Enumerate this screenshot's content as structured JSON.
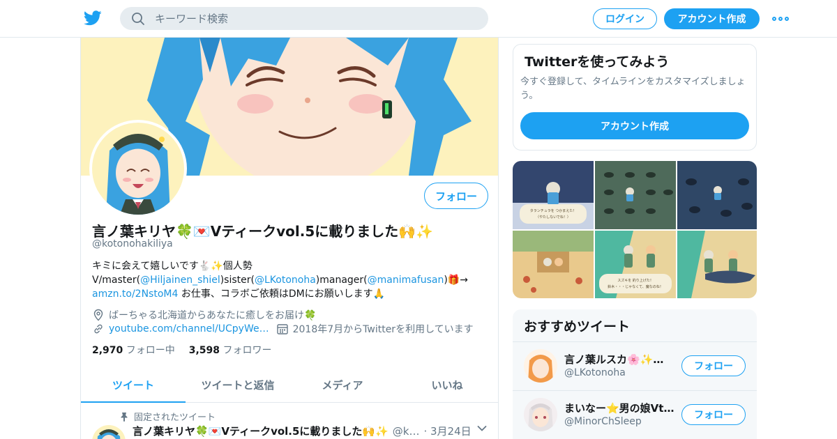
{
  "colors": {
    "brand": "#1da1f2",
    "link": "#1b95e0",
    "muted": "#657786",
    "text": "#14171a",
    "banner_bg": "#fdf2bd",
    "hair": "#3aa2e0"
  },
  "header": {
    "logo_icon": "twitter-bird-icon",
    "search_placeholder": "キーワード検索",
    "search_icon": "search-icon",
    "login_label": "ログイン",
    "signup_label": "アカウント作成",
    "more_icon": "more-dots-icon"
  },
  "profile": {
    "follow_label": "フォロー",
    "name": "言ノ葉キリヤ🍀💌Vティークvol.5に載りました🙌✨",
    "handle": "@kotonohakiliya",
    "bio": {
      "line1": "キミに会えて嬉しいです🐇✨個人勢",
      "l2_a": "V/master(",
      "l2_link1": "@Hiljainen_shiel",
      "l2_b": ")sister(",
      "l2_link2": "@LKotonoha",
      "l2_c": ")manager(",
      "l2_link3": "@manimafusan",
      "l2_d": ")🎁→",
      "l3_link": "amzn.to/2NstoM4",
      "l3_text": " お仕事、コラボご依頼はDMにお願いします🙏"
    },
    "location": "ばーちゃる北海道からあなたに癒しをお届け🍀",
    "location_icon": "location-pin-icon",
    "url": "youtube.com/channel/UCpyWe…",
    "url_icon": "link-icon",
    "joined": "2018年7月からTwitterを利用しています",
    "joined_icon": "calendar-icon",
    "following_count": "2,970",
    "following_label": "フォロー中",
    "followers_count": "3,598",
    "followers_label": "フォロワー"
  },
  "tabs": [
    {
      "label": "ツイート"
    },
    {
      "label": "ツイートと返信"
    },
    {
      "label": "メディア"
    },
    {
      "label": "いいね"
    }
  ],
  "pinned_tweet": {
    "pinned_label": "固定されたツイート",
    "pin_icon": "pin-icon",
    "name": "言ノ葉キリヤ🍀💌Vティークvol.5に載りました🙌✨",
    "handle": "@k…",
    "date": "· 3月24日",
    "caret_icon": "chevron-down-icon"
  },
  "signup_card": {
    "title": "Twitterを使ってみよう",
    "description": "今すぐ登録して、タイムラインをカスタマイズしましょう。",
    "button_label": "アカウント作成"
  },
  "media": {
    "caption_1": "タランチュラを つかまえた！\n（やたしないでね！）",
    "caption_5": "スズキを 釣り上げた！\n鈴木・・・じゃなくて、魔なのね！"
  },
  "recommended": {
    "title": "おすすめツイート",
    "items": [
      {
        "name": "言ノ葉ルスカ🌸✨…",
        "handle": "@LKotonoha",
        "follow_label": "フォロー"
      },
      {
        "name": "まいなー⭐男の娘Vt…",
        "handle": "@MinorChSleep",
        "follow_label": "フォロー"
      }
    ]
  }
}
